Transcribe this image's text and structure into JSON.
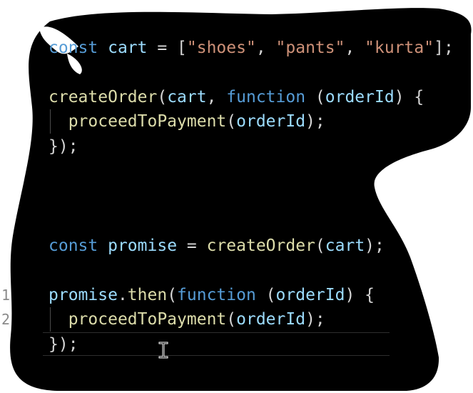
{
  "editor": {
    "gutter": [
      "1",
      "2"
    ],
    "lines": [
      [
        {
          "t": "const",
          "c": "kw"
        },
        {
          "t": " ",
          "c": "pun"
        },
        {
          "t": "cart",
          "c": "var"
        },
        {
          "t": " = [",
          "c": "pun"
        },
        {
          "t": "\"shoes\"",
          "c": "str"
        },
        {
          "t": ", ",
          "c": "pun"
        },
        {
          "t": "\"pants\"",
          "c": "str"
        },
        {
          "t": ", ",
          "c": "pun"
        },
        {
          "t": "\"kurta\"",
          "c": "str"
        },
        {
          "t": "];",
          "c": "pun"
        }
      ],
      [],
      [
        {
          "t": "createOrder",
          "c": "fn"
        },
        {
          "t": "(",
          "c": "pun"
        },
        {
          "t": "cart",
          "c": "var"
        },
        {
          "t": ", ",
          "c": "pun"
        },
        {
          "t": "function",
          "c": "kw"
        },
        {
          "t": " (",
          "c": "pun"
        },
        {
          "t": "orderId",
          "c": "var"
        },
        {
          "t": ") {",
          "c": "pun"
        }
      ],
      [
        {
          "t": "  ",
          "c": "pun"
        },
        {
          "t": "proceedToPayment",
          "c": "fn"
        },
        {
          "t": "(",
          "c": "pun"
        },
        {
          "t": "orderId",
          "c": "var"
        },
        {
          "t": ");",
          "c": "pun"
        }
      ],
      [
        {
          "t": "});",
          "c": "pun"
        }
      ],
      [],
      [],
      [],
      [
        {
          "t": "const",
          "c": "kw"
        },
        {
          "t": " ",
          "c": "pun"
        },
        {
          "t": "promise",
          "c": "var"
        },
        {
          "t": " = ",
          "c": "pun"
        },
        {
          "t": "createOrder",
          "c": "fn"
        },
        {
          "t": "(",
          "c": "pun"
        },
        {
          "t": "cart",
          "c": "var"
        },
        {
          "t": ");",
          "c": "pun"
        }
      ],
      [],
      [
        {
          "t": "promise",
          "c": "var"
        },
        {
          "t": ".",
          "c": "pun"
        },
        {
          "t": "then",
          "c": "fn"
        },
        {
          "t": "(",
          "c": "pun"
        },
        {
          "t": "function",
          "c": "kw"
        },
        {
          "t": " (",
          "c": "pun"
        },
        {
          "t": "orderId",
          "c": "var"
        },
        {
          "t": ") {",
          "c": "pun"
        }
      ],
      [
        {
          "t": "  ",
          "c": "pun"
        },
        {
          "t": "proceedToPayment",
          "c": "fn"
        },
        {
          "t": "(",
          "c": "pun"
        },
        {
          "t": "orderId",
          "c": "var"
        },
        {
          "t": ");",
          "c": "pun"
        }
      ],
      [
        {
          "t": "});",
          "c": "pun"
        }
      ]
    ]
  },
  "colors": {
    "background": "#000000",
    "keyword": "#569cd6",
    "variable": "#9cdcfe",
    "function": "#dcdcaa",
    "string": "#ce9178",
    "punctuation": "#d4d4d4"
  },
  "icons": {
    "cursor": "text-cursor-icon"
  }
}
